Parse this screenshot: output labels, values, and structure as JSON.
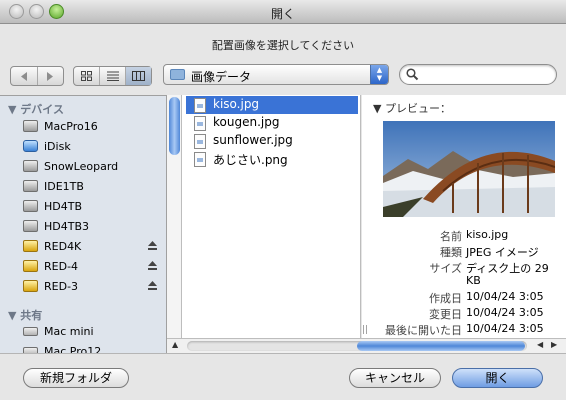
{
  "window": {
    "title": "開く"
  },
  "prompt": "配置画像を選択してください",
  "toolbar": {
    "location": "画像データ",
    "search": {
      "value": "",
      "placeholder": ""
    }
  },
  "sidebar": {
    "sections": [
      {
        "title": "▼ デバイス",
        "items": [
          {
            "label": "MacPro16",
            "icon": "hard-drive-icon"
          },
          {
            "label": "iDisk",
            "icon": "idisk-icon"
          },
          {
            "label": "SnowLeopard",
            "icon": "hard-drive-icon"
          },
          {
            "label": "IDE1TB",
            "icon": "hard-drive-icon"
          },
          {
            "label": "HD4TB",
            "icon": "hard-drive-icon"
          },
          {
            "label": "HD4TB3",
            "icon": "hard-drive-icon"
          },
          {
            "label": "RED4K",
            "icon": "external-drive-icon",
            "eject": true
          },
          {
            "label": "RED-4",
            "icon": "external-drive-icon",
            "eject": true
          },
          {
            "label": "RED-3",
            "icon": "external-drive-icon",
            "eject": true
          }
        ]
      },
      {
        "title": "▼ 共有",
        "items": [
          {
            "label": "Mac mini",
            "icon": "mac-mini-icon"
          },
          {
            "label": "Mac Pro12",
            "icon": "mac-pro-icon"
          }
        ]
      }
    ]
  },
  "files": [
    {
      "name": "kiso.jpg",
      "selected": true
    },
    {
      "name": "kougen.jpg",
      "selected": false
    },
    {
      "name": "sunflower.jpg",
      "selected": false
    },
    {
      "name": "あじさい.png",
      "selected": false
    }
  ],
  "preview": {
    "label": "▼ プレビュー：",
    "info": [
      {
        "key": "名前",
        "value": "kiso.jpg"
      },
      {
        "key": "種類",
        "value": "JPEG イメージ"
      },
      {
        "key": "サイズ",
        "value": "ディスク上の 29"
      },
      {
        "key": "",
        "value": "KB"
      },
      {
        "key": "作成日",
        "value": "10/04/24 3:05"
      },
      {
        "key": "変更日",
        "value": "10/04/24 3:05"
      },
      {
        "key": "最後に開いた日",
        "value": "10/04/24 3:05"
      }
    ]
  },
  "buttons": {
    "new_folder": "新規フォルダ",
    "cancel": "キャンセル",
    "open": "開く"
  },
  "colors": {
    "selection": "#3a73d6",
    "sidebar_bg": "#dee4ec",
    "accent": "#4f87d8"
  }
}
